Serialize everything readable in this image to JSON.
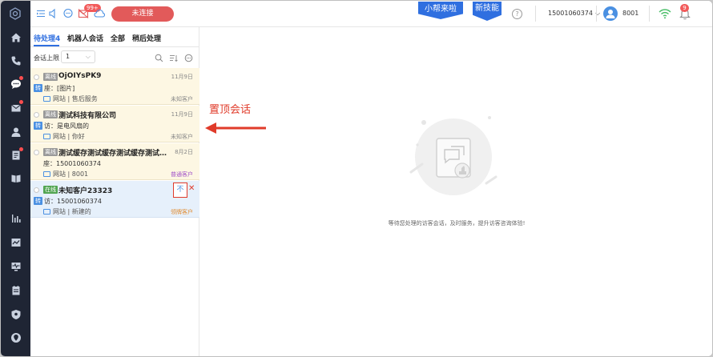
{
  "topbar": {
    "badge_count": "99+",
    "connect_label": "未连接",
    "xiaobang_label": "小帮来啦",
    "new_skill_label": "新技能",
    "help_label": "?",
    "phone_number": "15001060374",
    "agent_id": "8001",
    "bell_count": "9"
  },
  "tabs": [
    {
      "label": "待处理4"
    },
    {
      "label": "机器人会话"
    },
    {
      "label": "全部"
    },
    {
      "label": "稍后处理"
    }
  ],
  "limit": {
    "label": "会话上限",
    "value": "1"
  },
  "conversations": [
    {
      "status": "离线",
      "name": "OjOIYsPK9",
      "date": "11月9日",
      "flag": "转",
      "line2": "座：[图片]",
      "line3": "网站 | 售后服务",
      "type": "未知客户"
    },
    {
      "status": "离线",
      "name": "测试科技有限公司",
      "date": "11月9日",
      "flag": "转",
      "line2": "访：是电风扇的",
      "line3": "网站 | 你好",
      "type": "未知客户"
    },
    {
      "status": "离线",
      "name": "测试缓存测试缓存测试缓存测试缓...",
      "date": "8月2日",
      "flag": "",
      "line2": "座：15001060374",
      "line3": "网站 | 8001",
      "type": "普通客户"
    },
    {
      "status": "在线",
      "name": "未知客户23323",
      "date": "",
      "flag": "转",
      "line2": "访：15001060374",
      "line3": "网站 | 新建的",
      "type": "领牌客户",
      "pin_label": "不",
      "close_label": "✕"
    }
  ],
  "annotation": {
    "text": "置顶会话"
  },
  "empty_state": {
    "text": "等待您处理的访客会话，及时服务，提升访客咨询体验!"
  },
  "colors": {
    "accent": "#2f6fe0",
    "sidebar": "#1f2534",
    "pending_bg": "#fdf7e3",
    "active_bg": "#e6f0fb",
    "alert": "#e03b2a"
  }
}
